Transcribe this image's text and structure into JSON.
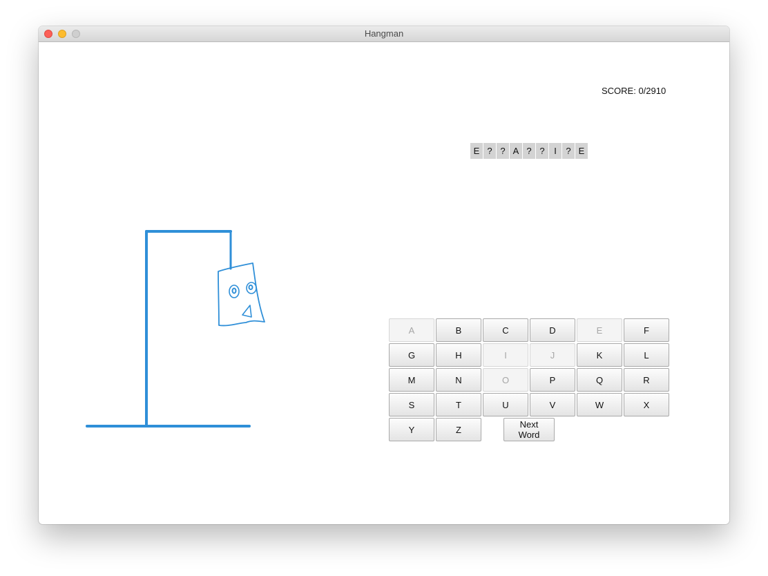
{
  "window": {
    "title": "Hangman"
  },
  "score": {
    "text": "SCORE: 0/2910"
  },
  "word": {
    "cells": [
      "E",
      "?",
      "?",
      "A",
      "?",
      "?",
      "I",
      "?",
      "E"
    ]
  },
  "keyboard": {
    "keys": [
      {
        "label": "A",
        "enabled": false
      },
      {
        "label": "B",
        "enabled": true
      },
      {
        "label": "C",
        "enabled": true
      },
      {
        "label": "D",
        "enabled": true
      },
      {
        "label": "E",
        "enabled": false
      },
      {
        "label": "F",
        "enabled": true
      },
      {
        "label": "G",
        "enabled": true
      },
      {
        "label": "H",
        "enabled": true
      },
      {
        "label": "I",
        "enabled": false
      },
      {
        "label": "J",
        "enabled": false
      },
      {
        "label": "K",
        "enabled": true
      },
      {
        "label": "L",
        "enabled": true
      },
      {
        "label": "M",
        "enabled": true
      },
      {
        "label": "N",
        "enabled": true
      },
      {
        "label": "O",
        "enabled": false
      },
      {
        "label": "P",
        "enabled": true
      },
      {
        "label": "Q",
        "enabled": true
      },
      {
        "label": "R",
        "enabled": true
      },
      {
        "label": "S",
        "enabled": true
      },
      {
        "label": "T",
        "enabled": true
      },
      {
        "label": "U",
        "enabled": true
      },
      {
        "label": "V",
        "enabled": true
      },
      {
        "label": "W",
        "enabled": true
      },
      {
        "label": "X",
        "enabled": true
      },
      {
        "label": "Y",
        "enabled": true
      },
      {
        "label": "Z",
        "enabled": true
      }
    ],
    "next_word_label": "Next Word"
  },
  "hangman": {
    "stroke_color": "#2f8fd8"
  }
}
